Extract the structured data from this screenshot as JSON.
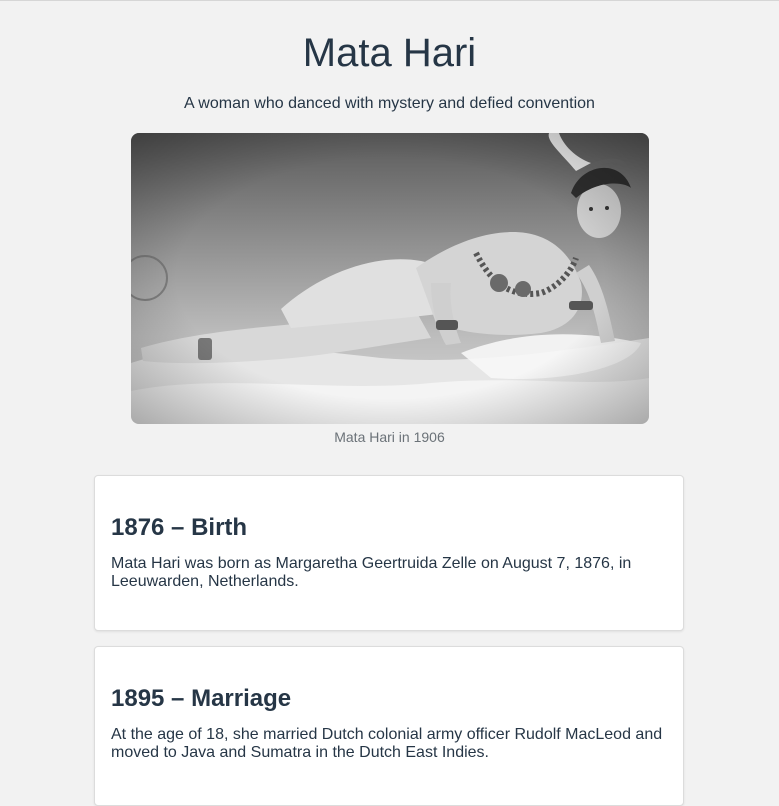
{
  "header": {
    "title": "Mata Hari",
    "subtitle": "A woman who danced with mystery and defied convention"
  },
  "hero": {
    "image_alt": "Mata Hari in 1906",
    "caption": "Mata Hari in 1906"
  },
  "timeline": [
    {
      "heading": "1876 – Birth",
      "text": "Mata Hari was born as Margaretha Geertruida Zelle on August 7, 1876, in Leeuwarden, Netherlands."
    },
    {
      "heading": "1895 – Marriage",
      "text": "At the age of 18, she married Dutch colonial army officer Rudolf MacLeod and moved to Java and Sumatra in the Dutch East Indies."
    }
  ],
  "colors": {
    "background": "#f2f2f2",
    "text": "#263646",
    "caption": "#6b7278",
    "card": "#ffffff"
  }
}
